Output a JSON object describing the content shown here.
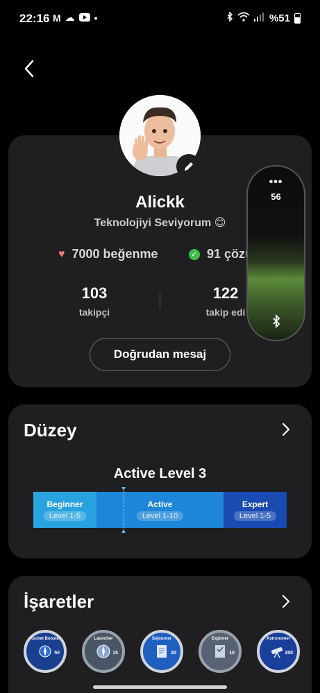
{
  "status": {
    "time": "22:16",
    "battery": "%51",
    "left_icons": [
      "gmail-icon",
      "cloud-icon",
      "youtube-icon",
      "dot-icon"
    ],
    "right_icons": [
      "bluetooth-icon",
      "wifi-icon",
      "signal-icon",
      "battery-icon"
    ]
  },
  "profile": {
    "name": "Alickk",
    "bio": "Teknolojiyi Seviyorum 😊",
    "likes": "7000 beğenme",
    "solutions": "91 çözü",
    "followers_count": "103",
    "followers_label": "takipçi",
    "following_count": "122",
    "following_label": "takip edi",
    "message_button": "Doğrudan mesaj"
  },
  "widget": {
    "dots": "•••",
    "value": "56"
  },
  "level": {
    "section_title": "Düzey",
    "current": "Active Level 3",
    "segments": [
      {
        "name": "Beginner",
        "range": "Level 1-5",
        "color": "#29a3e0"
      },
      {
        "name": "Active",
        "range": "Level 1-10",
        "color": "#1d86d8"
      },
      {
        "name": "Expert",
        "range": "Level 1-5",
        "color": "#1a4bb2"
      }
    ]
  },
  "badges": {
    "section_title": "İşaretler",
    "items": [
      {
        "name": "Rocket Booster",
        "number": "50"
      },
      {
        "name": "Launcher",
        "number": "15"
      },
      {
        "name": "Sojourner",
        "number": "20"
      },
      {
        "name": "Explorer",
        "number": "10"
      },
      {
        "name": "Astronomer",
        "number": "200"
      }
    ]
  }
}
